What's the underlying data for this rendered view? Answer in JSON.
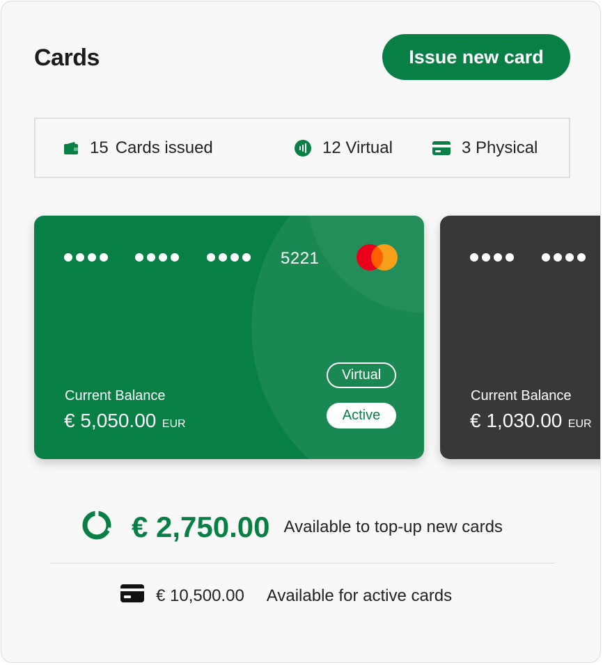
{
  "header": {
    "title": "Cards",
    "issue_button_label": "Issue new card"
  },
  "stats": {
    "issued_count": "15",
    "issued_label": "Cards issued",
    "virtual": "12 Virtual",
    "physical": "3 Physical",
    "icons": [
      "wallet-icon",
      "contactless-icon",
      "card-icon"
    ]
  },
  "cards": [
    {
      "masked_groups": [
        "••••",
        "••••",
        "••••"
      ],
      "last4": "5221",
      "brand_icon": "mastercard-logo",
      "balance_label": "Current Balance",
      "balance": "€ 5,050.00",
      "currency": "EUR",
      "type_badge": "Virtual",
      "status_badge": "Active",
      "color": "#087f45"
    },
    {
      "masked_groups": [
        "••••",
        "••••"
      ],
      "balance_label": "Current Balance",
      "balance": "€ 1,030.00",
      "currency": "EUR",
      "color": "#383838"
    }
  ],
  "summary": {
    "topup_amount": "€ 2,750.00",
    "topup_label": "Available to top-up new cards",
    "topup_fraction": 0.85,
    "active_amount": "€ 10,500.00",
    "active_label": "Available for active cards"
  },
  "colors": {
    "accent": "#087f45",
    "dark_card": "#383838",
    "mastercard_red": "#eb001b",
    "mastercard_orange": "#f79e1b"
  }
}
